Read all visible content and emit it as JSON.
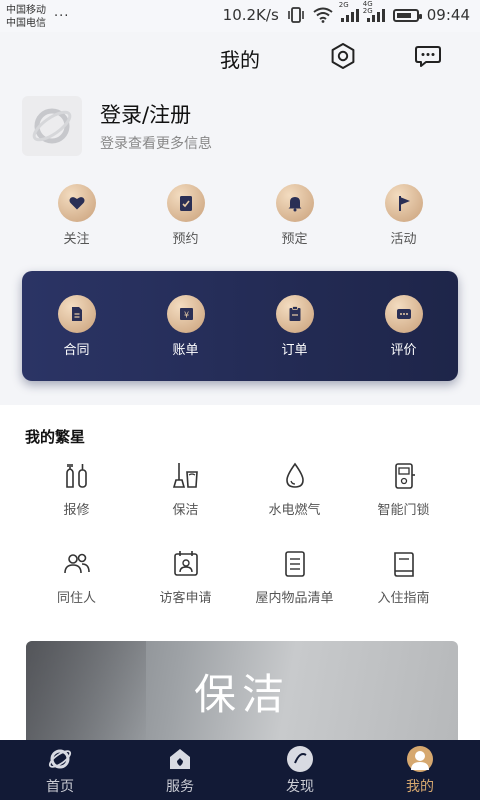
{
  "status_bar": {
    "carrier_1": "中国移动",
    "carrier_2": "中国电信",
    "more": "...",
    "net_speed": "10.2K/s",
    "signal_1_label": "2G",
    "signal_2_label": "4G 2G",
    "time": "09:44"
  },
  "header": {
    "title": "我的",
    "settings_icon": "gear-icon",
    "message_icon": "chat-icon"
  },
  "profile": {
    "login_label": "登录/注册",
    "login_hint": "登录查看更多信息"
  },
  "quick_actions": [
    {
      "label": "关注",
      "icon": "heart-icon"
    },
    {
      "label": "预约",
      "icon": "clipboard-check-icon"
    },
    {
      "label": "预定",
      "icon": "bell-icon"
    },
    {
      "label": "活动",
      "icon": "flag-icon"
    }
  ],
  "card_actions": [
    {
      "label": "合同",
      "icon": "document-icon"
    },
    {
      "label": "账单",
      "icon": "yen-bill-icon"
    },
    {
      "label": "订单",
      "icon": "order-icon"
    },
    {
      "label": "评价",
      "icon": "comment-icon"
    }
  ],
  "my_section": {
    "title": "我的繁星",
    "items": [
      {
        "label": "报修",
        "icon": "repair-icon"
      },
      {
        "label": "保洁",
        "icon": "cleaning-icon"
      },
      {
        "label": "水电燃气",
        "icon": "water-drop-icon"
      },
      {
        "label": "智能门锁",
        "icon": "door-lock-icon"
      },
      {
        "label": "同住人",
        "icon": "people-icon"
      },
      {
        "label": "访客申请",
        "icon": "visitor-icon"
      },
      {
        "label": "屋内物品清单",
        "icon": "list-icon"
      },
      {
        "label": "入住指南",
        "icon": "guide-icon"
      }
    ]
  },
  "banner": {
    "title": "保洁"
  },
  "bottom_nav": [
    {
      "label": "首页",
      "icon": "home-planet-icon",
      "active": false
    },
    {
      "label": "服务",
      "icon": "service-house-icon",
      "active": false
    },
    {
      "label": "发现",
      "icon": "discover-icon",
      "active": false
    },
    {
      "label": "我的",
      "icon": "person-icon",
      "active": true
    }
  ],
  "colors": {
    "accent_gold": "#d6a86f",
    "card_navy": "#242c58",
    "nav_bg": "#121a36"
  }
}
